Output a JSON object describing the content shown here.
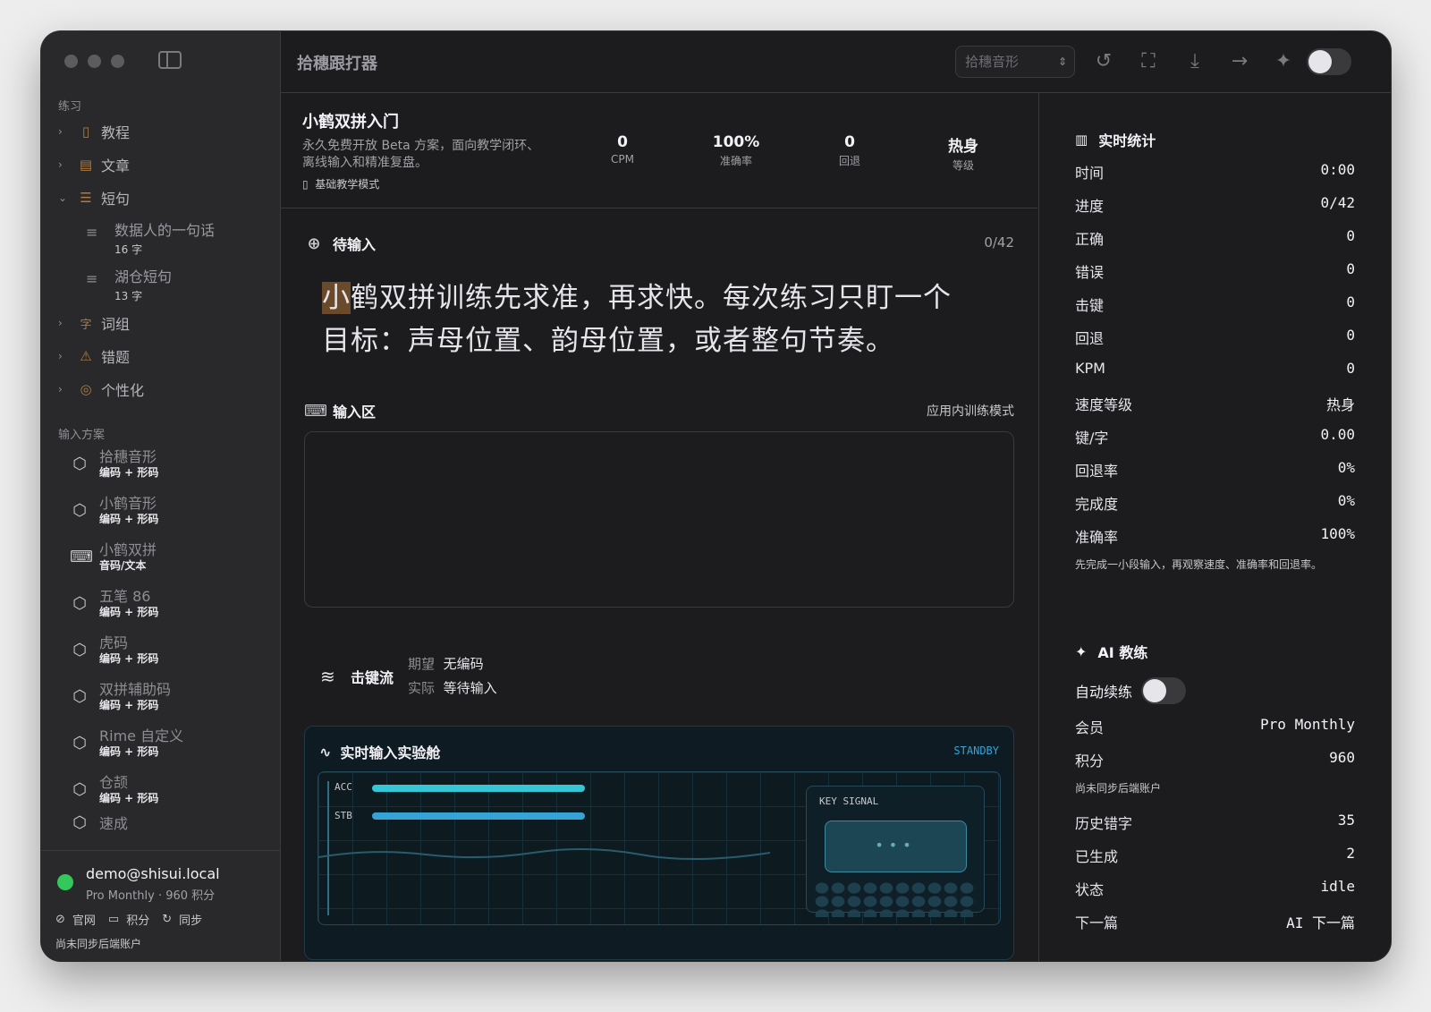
{
  "app": {
    "title": "拾穗跟打器",
    "scheme_select": "拾穗音形",
    "colors": {
      "accent": "#35c6d6",
      "warn": "#b07a42",
      "online": "#34c759",
      "standby": "#35a3d6"
    }
  },
  "sidebar": {
    "practice_label": "练习",
    "nav": [
      {
        "label": "教程",
        "icon": "book-icon",
        "glyph": "📖"
      },
      {
        "label": "文章",
        "icon": "document-icon",
        "glyph": "▤"
      },
      {
        "label": "短句",
        "icon": "list-icon",
        "glyph": "☰"
      },
      {
        "label": "词组",
        "icon": "text-icon",
        "glyph": "字"
      },
      {
        "label": "错题",
        "icon": "warning-icon",
        "glyph": "⚠"
      },
      {
        "label": "个性化",
        "icon": "target-icon",
        "glyph": "◎"
      }
    ],
    "short_items": [
      {
        "name": "数据人的一句话",
        "count": "16 字"
      },
      {
        "name": "湖仓短句",
        "count": "13 字"
      }
    ],
    "schemes_label": "输入方案",
    "schemes": [
      {
        "name": "拾穗音形",
        "desc": "编码 + 形码",
        "icon": "hexagon-icon"
      },
      {
        "name": "小鹤音形",
        "desc": "编码 + 形码",
        "icon": "hexagon-icon"
      },
      {
        "name": "小鹤双拼",
        "desc": "音码/文本",
        "icon": "keyboard-icon"
      },
      {
        "name": "五笔 86",
        "desc": "编码 + 形码",
        "icon": "hexagon-icon"
      },
      {
        "name": "虎码",
        "desc": "编码 + 形码",
        "icon": "hexagon-icon"
      },
      {
        "name": "双拼辅助码",
        "desc": "编码 + 形码",
        "icon": "hexagon-icon"
      },
      {
        "name": "Rime 自定义",
        "desc": "编码 + 形码",
        "icon": "hexagon-icon"
      },
      {
        "name": "仓颉",
        "desc": "编码 + 形码",
        "icon": "hexagon-icon"
      },
      {
        "name": "速成",
        "desc": "",
        "icon": "hexagon-icon"
      }
    ],
    "footer": {
      "email": "demo@shisui.local",
      "plan": "Pro Monthly · 960 积分",
      "links": [
        "官网",
        "积分",
        "同步"
      ],
      "sync_note": "尚未同步后端账户"
    }
  },
  "lesson": {
    "title": "小鹤双拼入门",
    "desc": "永久免费开放 Beta 方案，面向教学闭环、离线输入和精准复盘。",
    "mode": "基础教学模式",
    "metrics": [
      {
        "value": "0",
        "label": "CPM"
      },
      {
        "value": "100%",
        "label": "准确率"
      },
      {
        "value": "0",
        "label": "回退"
      },
      {
        "value": "热身",
        "label": "等级"
      }
    ]
  },
  "target": {
    "heading": "待输入",
    "progress": "0/42",
    "first_char": "小",
    "rest_text": "鹤双拼训练先求准，再求快。每次练习只盯一个目标：声母位置、韵母位置，或者整句节奏。"
  },
  "input": {
    "heading": "输入区",
    "mode_hint": "应用内训练模式"
  },
  "keystream": {
    "heading": "击键流",
    "expected_label": "期望",
    "expected_value": "无编码",
    "actual_label": "实际",
    "actual_value": "等待输入"
  },
  "lab": {
    "heading": "实时输入实验舱",
    "status": "STANDBY",
    "bars": [
      {
        "label": "ACC",
        "fraction": 1.0
      },
      {
        "label": "STB",
        "fraction": 1.0
      }
    ],
    "key_signal": "KEY SIGNAL"
  },
  "stats": {
    "heading": "实时统计",
    "rows": [
      {
        "label": "时间",
        "value": "0:00"
      },
      {
        "label": "进度",
        "value": "0/42"
      },
      {
        "label": "正确",
        "value": "0"
      },
      {
        "label": "错误",
        "value": "0"
      },
      {
        "label": "击键",
        "value": "0"
      },
      {
        "label": "回退",
        "value": "0"
      },
      {
        "label": "KPM",
        "value": "0"
      },
      {
        "label": "速度等级",
        "value": "热身"
      },
      {
        "label": "键/字",
        "value": "0.00"
      },
      {
        "label": "回退率",
        "value": "0%"
      },
      {
        "label": "完成度",
        "value": "0%"
      },
      {
        "label": "准确率",
        "value": "100%"
      }
    ],
    "note": "先完成一小段输入，再观察速度、准确率和回退率。"
  },
  "coach": {
    "heading": "AI 教练",
    "auto_label": "自动续练",
    "auto_on": false,
    "member_label": "会员",
    "member_value": "Pro Monthly",
    "points_label": "积分",
    "points_value": "960",
    "sync_note": "尚未同步后端账户",
    "rows": [
      {
        "label": "历史错字",
        "value": "35"
      },
      {
        "label": "已生成",
        "value": "2"
      },
      {
        "label": "状态",
        "value": "idle"
      },
      {
        "label": "下一篇",
        "value": "AI 下一篇"
      }
    ]
  }
}
